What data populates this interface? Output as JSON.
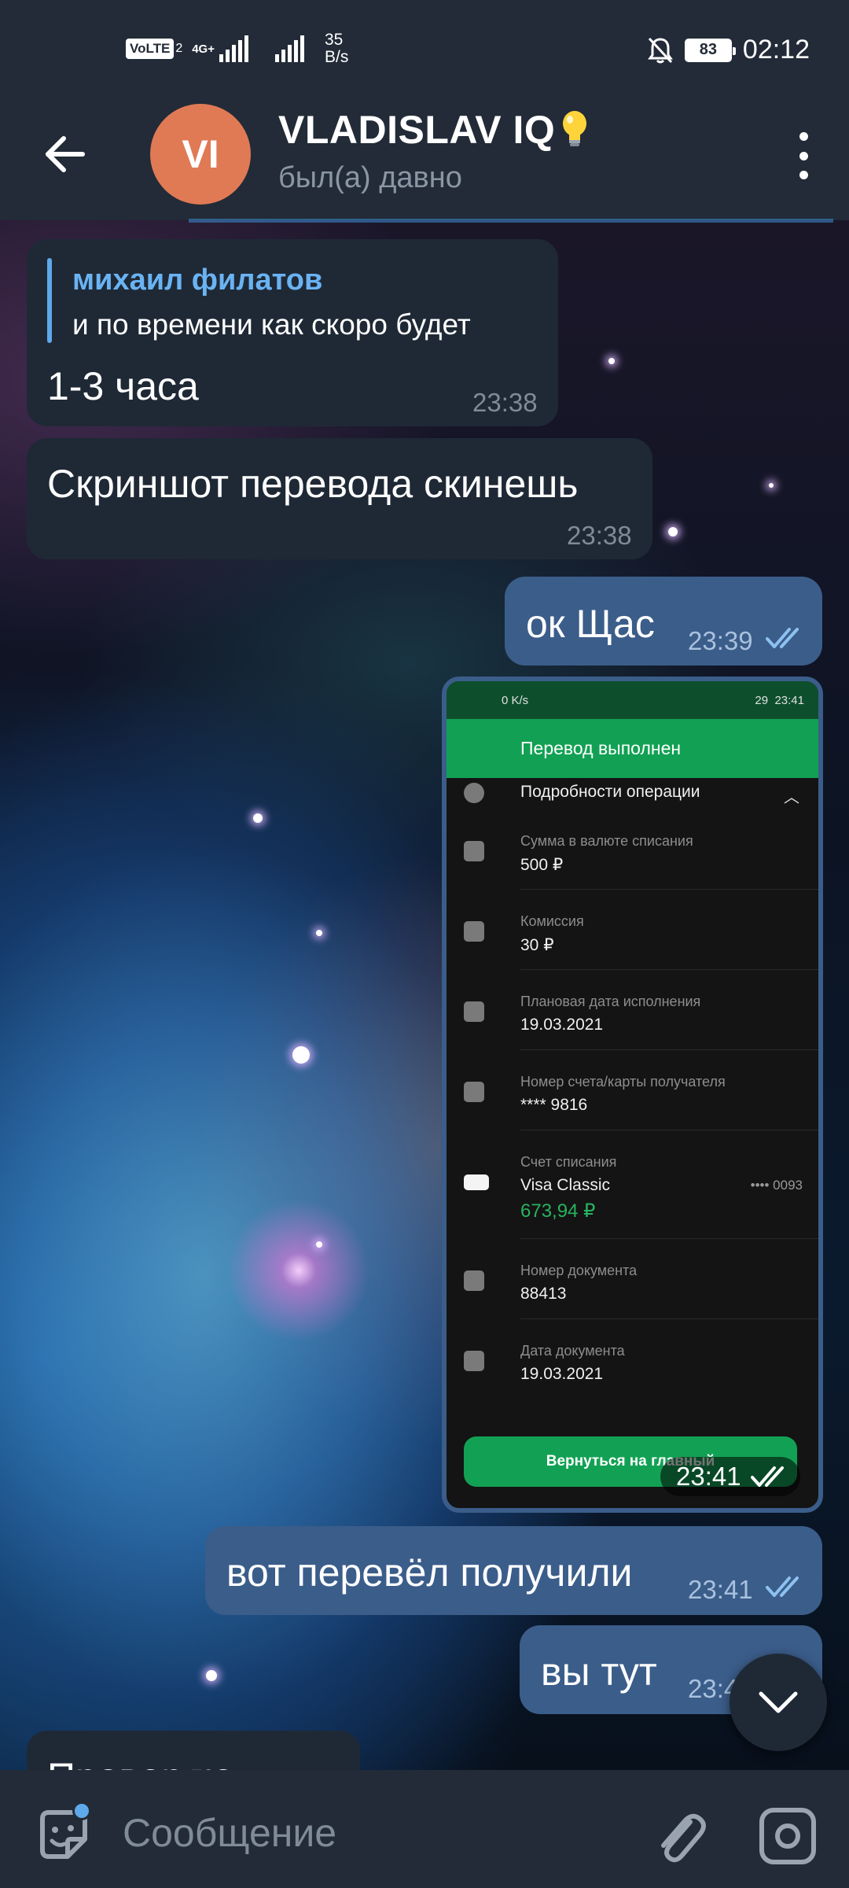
{
  "status_bar": {
    "volte": "VoLTE",
    "sim_index": "2",
    "network": "4G+",
    "net_speed_value": "35",
    "net_speed_unit": "B/s",
    "battery": "83",
    "time": "02:12"
  },
  "header": {
    "avatar_initials": "VI",
    "contact_name": "VLADISLAV IQ",
    "status": "был(а) давно"
  },
  "messages": [
    {
      "reply_name": "михаил филатов",
      "reply_text": "и по времени как скоро будет",
      "text": "1-3 часа",
      "time": "23:38"
    },
    {
      "text": "Скриншот перевода скинешь",
      "time": "23:38"
    },
    {
      "text": "ок Щас",
      "time": "23:39"
    },
    {
      "time": "23:41"
    },
    {
      "text": "вот перевёл получили",
      "time": "23:41"
    },
    {
      "text": "вы тут",
      "time": "23:4"
    },
    {
      "text": "Проверяю"
    }
  ],
  "screenshot_image": {
    "status_time": "23:41",
    "status_battery": "29",
    "status_speed": "0 K/s",
    "title": "Перевод выполнен",
    "section": "Подробности операции",
    "rows": [
      {
        "label": "Сумма в валюте списания",
        "value": "500 ₽"
      },
      {
        "label": "Комиссия",
        "value": "30 ₽"
      },
      {
        "label": "Плановая дата исполнения",
        "value": "19.03.2021"
      },
      {
        "label": "Номер счета/карты получателя",
        "value": "**** 9816"
      },
      {
        "label": "Счет списания",
        "value": "Visa Classic",
        "extra": "•••• 0093",
        "amount": "673,94 ₽"
      },
      {
        "label": "Номер документа",
        "value": "88413"
      },
      {
        "label": "Дата документа",
        "value": "19.03.2021"
      }
    ],
    "button": "Вернуться на главный"
  },
  "input": {
    "placeholder": "Сообщение"
  },
  "colors": {
    "header_bg": "#222b37",
    "incoming_bubble": "#1f2936",
    "outgoing_bubble": "#3b5d8a",
    "accent": "#6ab3f3",
    "avatar": "#e07a55",
    "sber_green": "#12a154"
  }
}
